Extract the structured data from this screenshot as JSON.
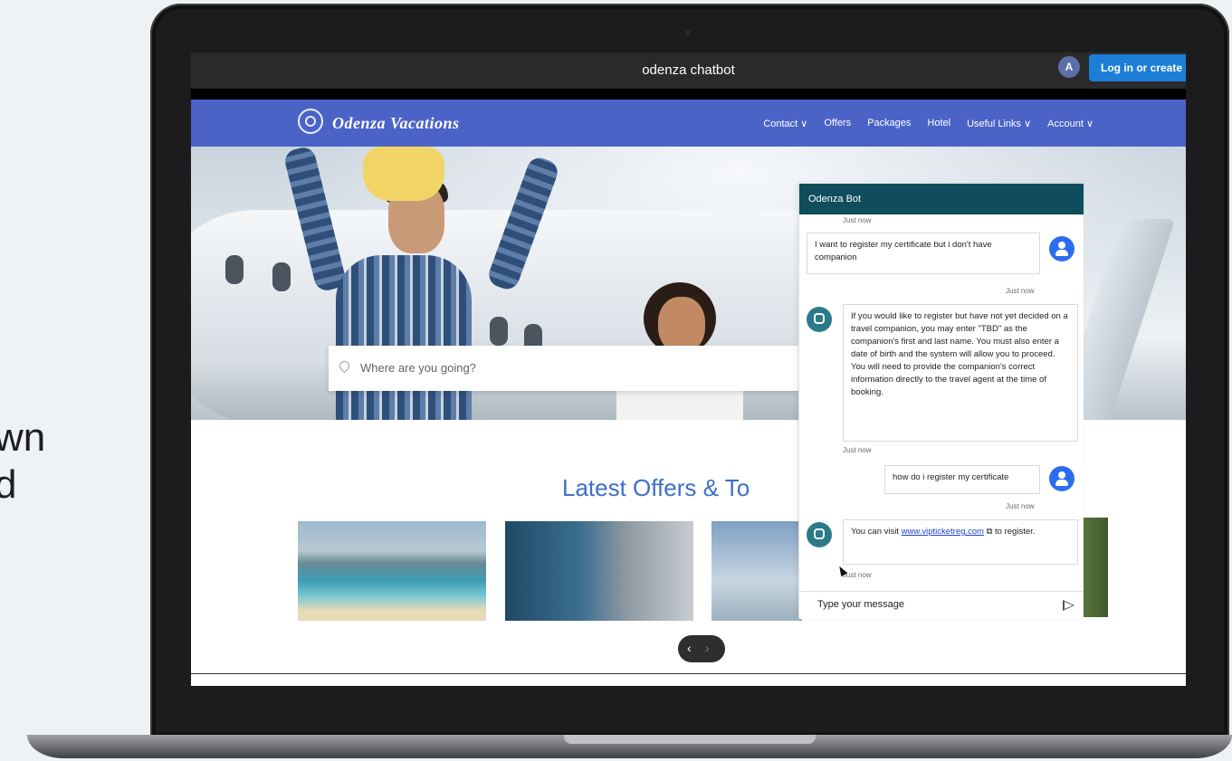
{
  "side_text": [
    "wn",
    "d"
  ],
  "browser": {
    "title": "odenza chatbot",
    "avatar_letter": "A",
    "login_label": "Log in or create a"
  },
  "site": {
    "brand": "Odenza Vacations",
    "nav": [
      "Contact ∨",
      "Offers",
      "Packages",
      "Hotel",
      "Useful Links ∨",
      "Account ∨"
    ],
    "search_placeholder": "Where are you going?",
    "offers_title": "Latest Offers & To"
  },
  "chat": {
    "header": "Odenza Bot",
    "messages": [
      {
        "from": "ts",
        "text": "Just now"
      },
      {
        "from": "user",
        "text": "I want to register my certificate but i don't have companion"
      },
      {
        "from": "ts",
        "text": "Just now"
      },
      {
        "from": "bot",
        "text": "If you would like to register but have not yet decided on a travel companion, you may enter \"TBD\" as the companion's first and last name. You must also enter a date of birth and the system will allow you to proceed. You will need to provide the companion's correct information directly to the travel agent at the time of booking."
      },
      {
        "from": "ts",
        "text": "Just now"
      },
      {
        "from": "user",
        "text": "how do i register my certificate"
      },
      {
        "from": "ts",
        "text": "Just now"
      },
      {
        "from": "bot",
        "text_before": "You can visit ",
        "link": "www.vipticketreg.com",
        "text_after": " ⧉ to register."
      },
      {
        "from": "ts",
        "text": "Just now"
      }
    ],
    "input_placeholder": "Type your message"
  },
  "pager": {
    "prev": "‹",
    "next": "›"
  },
  "colors": {
    "nav": "#4b63c7",
    "chat_header": "#0f4c5c",
    "login": "#1c7ed6",
    "accent_title": "#3e6fc9"
  }
}
